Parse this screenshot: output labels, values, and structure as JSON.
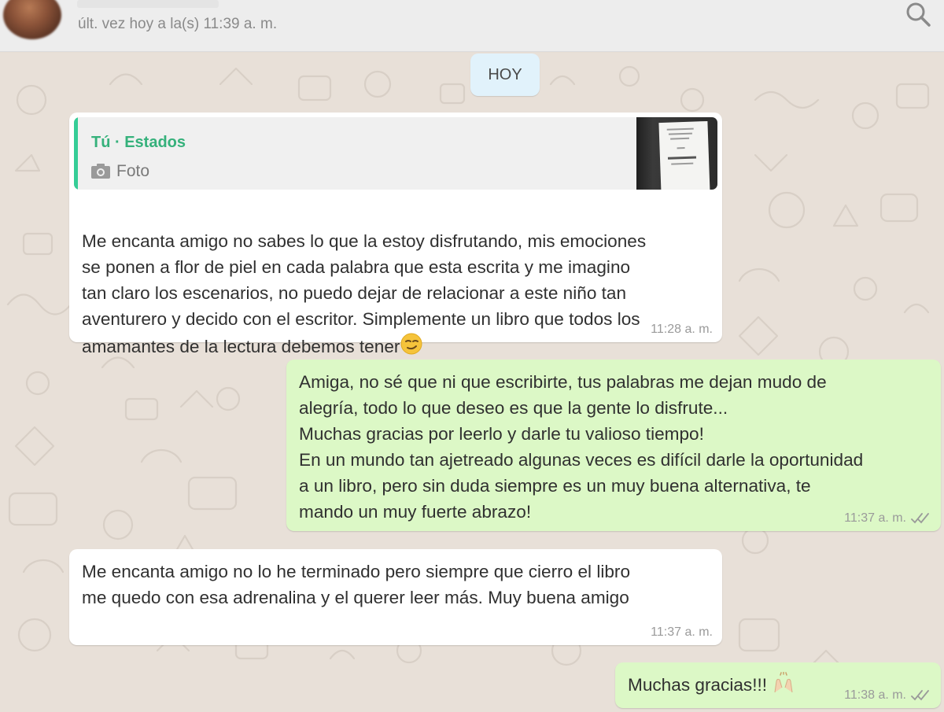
{
  "header": {
    "last_seen": "últ. vez hoy a la(s) 11:39 a. m.",
    "icons": [
      "avatar",
      "search-icon"
    ]
  },
  "day_divider": "HOY",
  "messages": [
    {
      "direction": "incoming",
      "quote": {
        "author": "Tú · Estados",
        "type_label": "Foto",
        "type_icon": "camera-icon"
      },
      "text": "Me encanta amigo no sabes lo que la estoy disfrutando, mis emociones\nse ponen a flor de piel en cada palabra que esta escrita y me imagino\ntan claro los escenarios, no puedo dejar de relacionar a este niño tan\naventurero y decido con el escritor. Simplemente un libro que todos los\namamantes de la lectura debemos tener",
      "emoji": "smirk-emoji",
      "time": "11:28 a. m."
    },
    {
      "direction": "outgoing",
      "text": "Amiga, no sé que ni que escribirte, tus palabras me dejan mudo de\nalegría, todo lo que deseo es que la gente lo disfrute...\nMuchas gracias por leerlo y darle tu valioso tiempo!\nEn un mundo tan ajetreado algunas veces es difícil darle la oportunidad\na un libro, pero sin duda siempre es un muy buena alternativa, te\nmando un muy fuerte abrazo!",
      "time": "11:37 a. m.",
      "status": "read"
    },
    {
      "direction": "incoming",
      "text": "Me encanta amigo no lo he terminado pero siempre que cierro el libro\nme quedo con esa adrenalina y el querer leer más. Muy buena amigo",
      "time": "11:37 a. m."
    },
    {
      "direction": "outgoing",
      "text": "Muchas gracias!!!",
      "emoji": "raising-hands-emoji",
      "time": "11:38 a. m.",
      "status": "read"
    }
  ],
  "colors": {
    "incoming_bubble": "#ffffff",
    "outgoing_bubble": "#dcf8c6",
    "quote_accent": "#35cd96",
    "chat_background": "#e5ddd5",
    "day_pill": "#e1f2fb"
  }
}
